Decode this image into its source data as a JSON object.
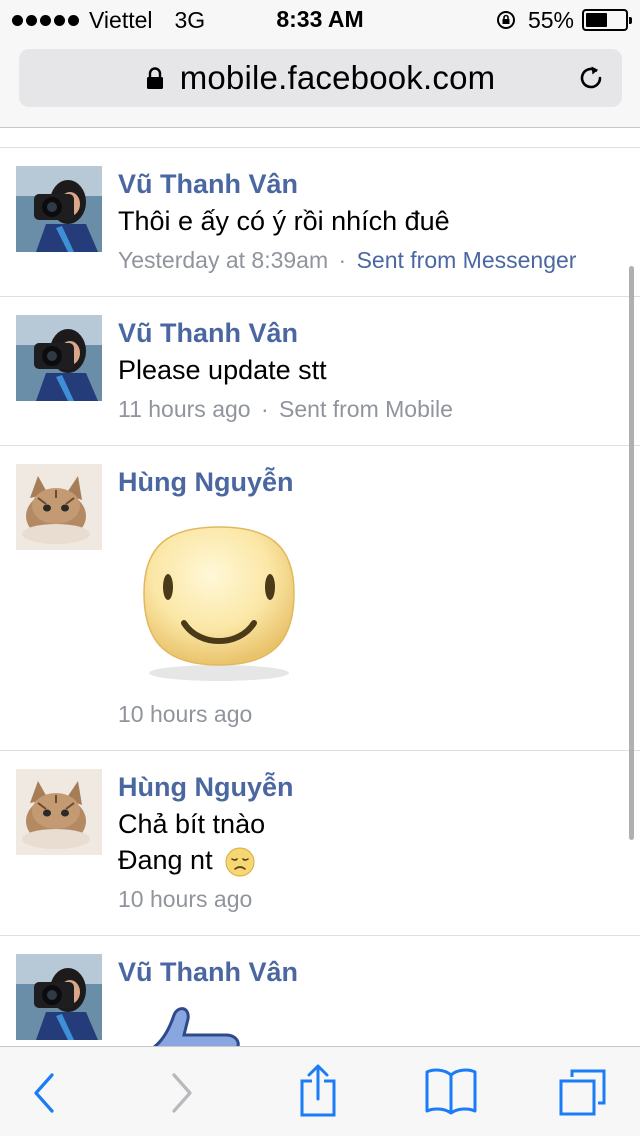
{
  "status_bar": {
    "carrier": "Viettel",
    "network": "3G",
    "time": "8:33 AM",
    "battery": "55%",
    "battery_level": 0.55
  },
  "url_bar": {
    "url": "mobile.facebook.com"
  },
  "messages": [
    {
      "author": "Vũ Thanh Vân",
      "lines": [
        "Thôi e ấy có ý rồi nhích đuê"
      ],
      "time": "Yesterday at 8:39am",
      "separator": "·",
      "via": "Sent from Messenger",
      "avatar": "avatar-camera-woman"
    },
    {
      "author": "Vũ Thanh Vân",
      "lines": [
        "Please update stt"
      ],
      "time": "11 hours ago",
      "separator": "·",
      "via": "Sent from Mobile",
      "avatar": "avatar-camera-woman"
    },
    {
      "author": "Hùng Nguyễn",
      "sticker": "big-smiley-sticker",
      "time": "10 hours ago",
      "avatar": "avatar-kitten"
    },
    {
      "author": "Hùng Nguyễn",
      "lines": [
        "Chả bít tnào",
        "Đang nt"
      ],
      "inline_emoji": "disappointed-face-icon",
      "time": "10 hours ago",
      "avatar": "avatar-kitten"
    },
    {
      "author": "Vũ Thanh Vân",
      "sticker": "thumbs-up-sticker",
      "avatar": "avatar-camera-woman"
    }
  ],
  "toolbar": {
    "icons": [
      "back-chevron-icon",
      "forward-chevron-icon",
      "share-icon",
      "bookmarks-icon",
      "tabs-icon"
    ],
    "accent_color": "#1a7cf6",
    "disabled_color": "#b8b8bd"
  },
  "colors": {
    "author_name": "#4b67a1",
    "meta_text": "#90949c",
    "divider": "#dddfe2"
  }
}
